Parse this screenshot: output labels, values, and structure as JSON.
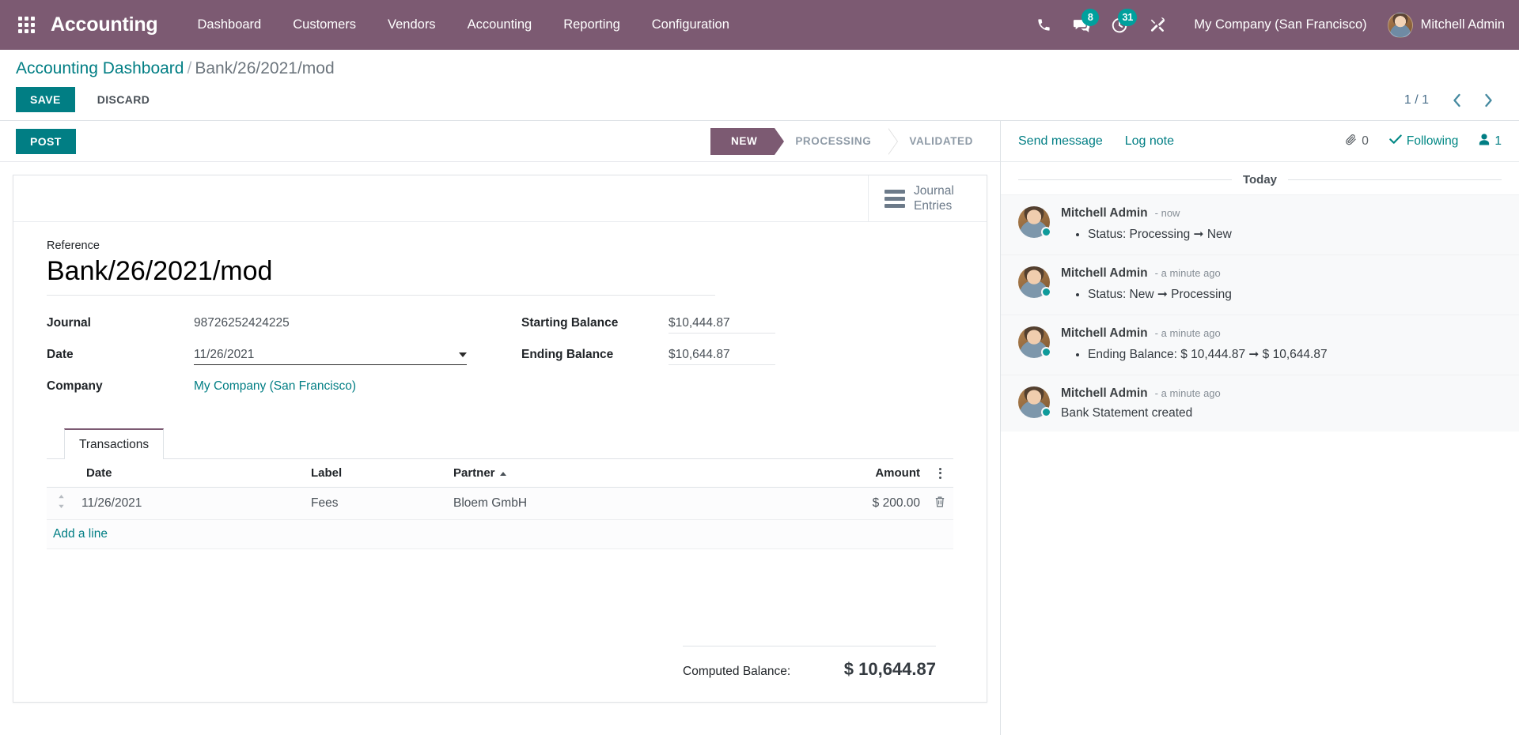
{
  "navbar": {
    "apps_icon": "grid-apps-icon",
    "brand": "Accounting",
    "menu": [
      {
        "label": "Dashboard"
      },
      {
        "label": "Customers"
      },
      {
        "label": "Vendors"
      },
      {
        "label": "Accounting"
      },
      {
        "label": "Reporting"
      },
      {
        "label": "Configuration"
      }
    ],
    "systray": {
      "phone_icon": "phone-icon",
      "messages_icon": "chat-bubble-icon",
      "messages_count": "8",
      "activities_icon": "clock-activity-icon",
      "activities_count": "31",
      "debug_icon": "wrench-tools-icon"
    },
    "company": "My Company (San Francisco)",
    "user": "Mitchell Admin",
    "accent_purple": "#7c5a72",
    "accent_teal": "#017e84",
    "badge_teal": "#00a09d"
  },
  "control_panel": {
    "breadcrumb_root": "Accounting Dashboard",
    "breadcrumb_separator": "/",
    "breadcrumb_current": "Bank/26/2021/mod",
    "save_label": "SAVE",
    "discard_label": "DISCARD",
    "pager_value": "1 / 1",
    "pager_prev_icon": "chevron-left-icon",
    "pager_next_icon": "chevron-right-icon"
  },
  "form": {
    "post_label": "POST",
    "statusbar": [
      {
        "label": "NEW",
        "active": true
      },
      {
        "label": "PROCESSING",
        "active": false
      },
      {
        "label": "VALIDATED",
        "active": false
      }
    ],
    "stat_button": {
      "icon": "list-bars-icon",
      "line1": "Journal",
      "line2": "Entries"
    },
    "reference_label": "Reference",
    "reference_value": "Bank/26/2021/mod",
    "fields_left": [
      {
        "label": "Journal",
        "value": "98726252424225",
        "type": "readonly"
      },
      {
        "label": "Date",
        "value": "11/26/2021",
        "type": "date"
      },
      {
        "label": "Company",
        "value": "My Company (San Francisco)",
        "type": "link"
      }
    ],
    "fields_right": [
      {
        "label": "Starting Balance",
        "value": "$10,444.87",
        "type": "monetary"
      },
      {
        "label": "Ending Balance",
        "value": "$10,644.87",
        "type": "monetary"
      }
    ],
    "notebook": {
      "tabs": [
        {
          "label": "Transactions",
          "active": true
        }
      ],
      "columns": [
        "Date",
        "Label",
        "Partner",
        "Amount"
      ],
      "sorted_column": "Partner",
      "sort_direction": "asc",
      "optional_columns_icon": "vertical-dots-icon",
      "rows": [
        {
          "handle_icon": "drag-handle-icon",
          "date": "11/26/2021",
          "label": "Fees",
          "partner": "Bloem GmbH",
          "amount": "$ 200.00",
          "delete_icon": "trash-icon"
        }
      ],
      "add_line_label": "Add a line",
      "totals_label": "Computed Balance:",
      "totals_value": "$ 10,644.87"
    }
  },
  "chatter": {
    "send_message": "Send message",
    "log_note": "Log note",
    "attachment_icon": "paperclip-icon",
    "attachment_count": "0",
    "following_icon": "check-icon",
    "following_label": "Following",
    "followers_icon": "user-icon",
    "followers_count": "1",
    "day_separator": "Today",
    "messages": [
      {
        "author": "Mitchell Admin",
        "date": "- now",
        "avatar_icon": "user-avatar",
        "bullets": [
          "Status: Processing ➞ New"
        ],
        "text": ""
      },
      {
        "author": "Mitchell Admin",
        "date": "- a minute ago",
        "avatar_icon": "user-avatar",
        "bullets": [
          "Status: New ➞ Processing"
        ],
        "text": ""
      },
      {
        "author": "Mitchell Admin",
        "date": "- a minute ago",
        "avatar_icon": "user-avatar",
        "bullets": [
          "Ending Balance: $ 10,444.87 ➞ $ 10,644.87"
        ],
        "text": ""
      },
      {
        "author": "Mitchell Admin",
        "date": "- a minute ago",
        "avatar_icon": "user-avatar",
        "bullets": [],
        "text": "Bank Statement created"
      }
    ]
  }
}
